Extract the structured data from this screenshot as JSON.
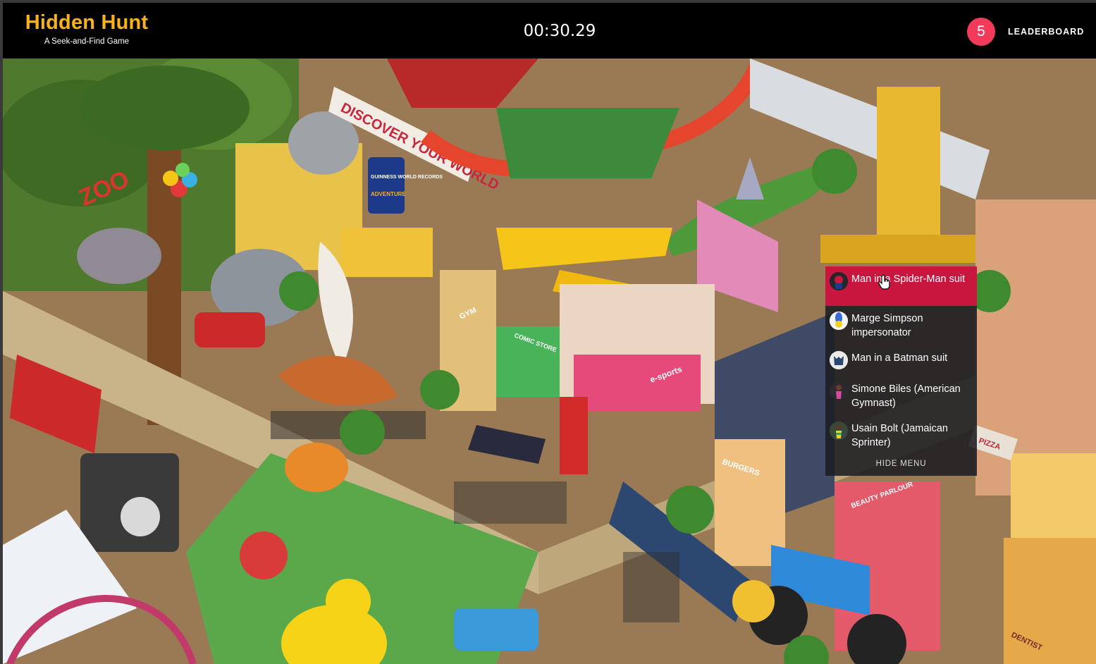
{
  "header": {
    "title": "Hidden Hunt",
    "subtitle": "A Seek-and-Find Game",
    "timer": "00:30.29",
    "remaining_count": "5",
    "leaderboard_label": "LEADERBOARD"
  },
  "scene": {
    "signs": {
      "discover": "DISCOVER YOUR WORLD",
      "zoo": "ZOO",
      "guinness": "GUINNESS WORLD RECORDS",
      "adventure": "ADVENTURE",
      "gym": "GYM",
      "comic_store": "COMIC STORE",
      "esports": "e-sports",
      "burgers": "BURGERS",
      "beauty_parlour": "BEAUTY PARLOUR",
      "pizza": "PIZZA",
      "dentist": "DENTIST"
    }
  },
  "menu": {
    "items": [
      {
        "label": "Man in a Spider-Man suit",
        "thumb_icon": "spiderman-thumb-icon",
        "active": true
      },
      {
        "label": "Marge Simpson impersonator",
        "thumb_icon": "marge-thumb-icon",
        "active": false
      },
      {
        "label": "Man in a Batman suit",
        "thumb_icon": "batman-thumb-icon",
        "active": false
      },
      {
        "label": "Simone Biles (American Gymnast)",
        "thumb_icon": "simone-biles-thumb-icon",
        "active": false
      },
      {
        "label": "Usain Bolt (Jamaican Sprinter)",
        "thumb_icon": "usain-bolt-thumb-icon",
        "active": false
      }
    ],
    "hide_label": "HIDE MENU"
  },
  "colors": {
    "brand": "#f8b21c",
    "badge": "#f43a5a",
    "active_item": "#c8163f",
    "topbar": "#000000"
  }
}
